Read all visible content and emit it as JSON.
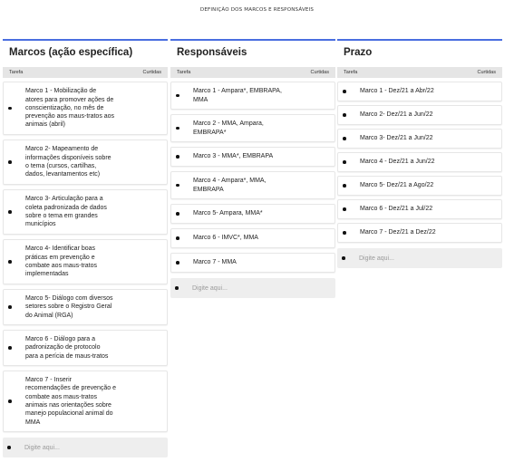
{
  "board": {
    "title": "DEFINIÇÃO DOS MARCOS E RESPONSÁVEIS"
  },
  "columns": [
    {
      "title": "Marcos (ação específica)",
      "left_label": "Tarefa",
      "right_label": "Curtidas",
      "cards": [
        "Marco 1 - Mobilização de\natores para promover ações de\nconscientização, no mês de\nprevenção aos maus-tratos aos\nanimais (abril)",
        "Marco 2- Mapeamento de\ninformações disponíveis sobre\no tema (cursos, cartilhas,\ndados, levantamentos etc)",
        "Marco 3- Articulação para a\ncoleta padronizada de dados\nsobre o tema em grandes\nmunicípios",
        "Marco 4- Identificar boas\npráticas em prevenção e\ncombate aos maus-tratos\nimplementadas",
        "Marco 5- Diálogo com diversos\nsetores sobre o Registro Geral\ndo Animal (RGA)",
        "Marco 6 - Diálogo para a\npadronização de protocolo\npara a perícia de maus-tratos",
        "Marco 7 - Inserir\nrecomendações de prevenção e\ncombate aos maus-tratos\nanimais nas orientações sobre\nmanejo populacional animal do\nMMA"
      ],
      "input_placeholder": "Digite aqui..."
    },
    {
      "title": "Responsáveis",
      "left_label": "Tarefa",
      "right_label": "Curtidas",
      "cards": [
        "Marco 1 - Ampara*, EMBRAPA,\nMMA",
        "Marco 2 - MMA, Ampara,\nEMBRAPA*",
        "Marco 3 - MMA*, EMBRAPA",
        "Marco 4 - Ampara*, MMA,\nEMBRAPA",
        "Marco 5- Ampara, MMA*",
        "Marco 6 - IMVC*, MMA",
        "Marco 7 - MMA"
      ],
      "input_placeholder": "Digite aqui..."
    },
    {
      "title": "Prazo",
      "left_label": "Tarefa",
      "right_label": "Curtidas",
      "cards": [
        "Marco 1 - Dez/21 a Abr/22",
        "Marco 2- Dez/21 a Jun/22",
        "Marco 3- Dez/21 a Jun/22",
        "Marco 4 - Dez/21 a Jun/22",
        "Marco 5- Dez/21 a Ago/22",
        "Marco 6 - Dez/21 a Jul/22",
        "Marco 7 - Dez/21 a Dez/22"
      ],
      "input_placeholder": "Digite aqui..."
    }
  ],
  "colors": {
    "accent": "#4a6ee0",
    "header_bar": "#e5e5e5",
    "input_bg": "#eeeeee"
  }
}
